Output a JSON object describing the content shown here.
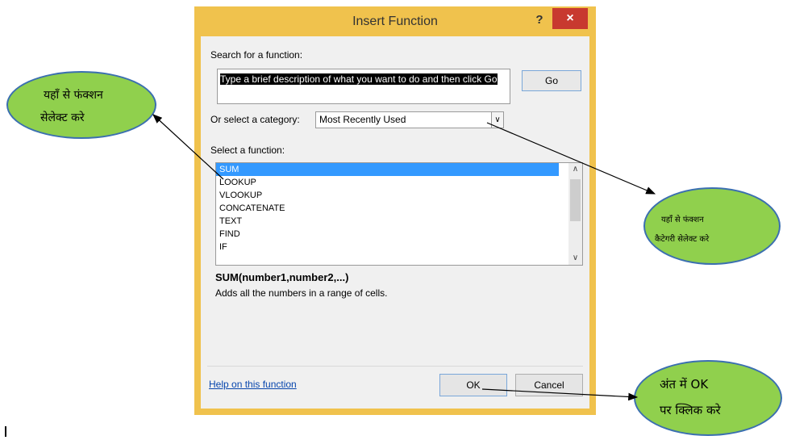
{
  "dialog": {
    "title": "Insert Function",
    "help_glyph": "?",
    "close_glyph": "×",
    "search_label": "Search for a function:",
    "search_value": "Type a brief description of what you want to do and then click Go",
    "go_label": "Go",
    "category_label": "Or select a category:",
    "category_value": "Most Recently Used",
    "select_function_label": "Select a function:",
    "functions": [
      "SUM",
      "LOOKUP",
      "VLOOKUP",
      "CONCATENATE",
      "TEXT",
      "FIND",
      "IF"
    ],
    "selected_function": "SUM",
    "signature": "SUM(number1,number2,...)",
    "description": "Adds all the numbers in a range of cells.",
    "help_link": "Help on this function",
    "ok_label": "OK",
    "cancel_label": "Cancel"
  },
  "callouts": {
    "select_function": [
      "यहाँ से फंक्शन",
      "सेलेक्ट करे"
    ],
    "select_category": [
      "यहाँ से फंक्शन",
      "कैटेगरी सेलेक्ट करे"
    ],
    "click_ok": [
      "अंत में OK",
      "पर क्लिक करे"
    ]
  },
  "colors": {
    "titlebar": "#f0c24d",
    "close_button": "#c8392f",
    "callout_fill": "#90d04d",
    "callout_border": "#3b6fb0",
    "selection": "#3399ff"
  }
}
